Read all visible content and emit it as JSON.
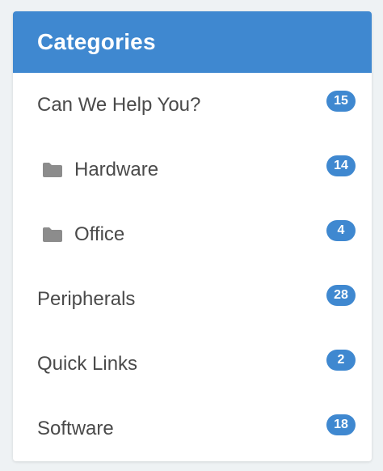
{
  "panel": {
    "title": "Categories",
    "accent_color": "#3f88d0",
    "items": [
      {
        "label": "Can We Help You?",
        "count": "15",
        "icon": "",
        "child": false
      },
      {
        "label": "Hardware",
        "count": "14",
        "icon": "folder-icon",
        "child": true
      },
      {
        "label": "Office",
        "count": "4",
        "icon": "folder-icon",
        "child": true
      },
      {
        "label": "Peripherals",
        "count": "28",
        "icon": "",
        "child": false
      },
      {
        "label": "Quick Links",
        "count": "2",
        "icon": "",
        "child": false
      },
      {
        "label": "Software",
        "count": "18",
        "icon": "",
        "child": false
      }
    ]
  }
}
